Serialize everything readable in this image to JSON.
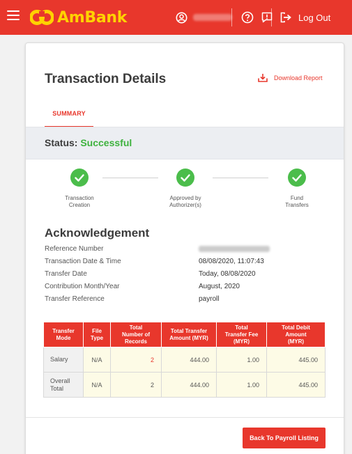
{
  "app": {
    "brand": "AmBank",
    "logout_label": "Log Out"
  },
  "page": {
    "title": "Transaction Details",
    "download_label": "Download Report",
    "tab_summary": "SUMMARY",
    "status_label": "Status:",
    "status_value": "Successful"
  },
  "steps": [
    {
      "label_line1": "Transaction",
      "label_line2": "Creation"
    },
    {
      "label_line1": "Approved by",
      "label_line2": "Authorizer(s)"
    },
    {
      "label_line1": "Fund",
      "label_line2": "Transfers"
    }
  ],
  "acknowledgement": {
    "title": "Acknowledgement",
    "rows": [
      {
        "label": "Reference Number",
        "value": ""
      },
      {
        "label": "Transaction Date & Time",
        "value": "08/08/2020, 11:07:43"
      },
      {
        "label": "Transfer Date",
        "value": "Today, 08/08/2020"
      },
      {
        "label": "Contribution Month/Year",
        "value": "August, 2020"
      },
      {
        "label": "Transfer Reference",
        "value": "payroll"
      }
    ]
  },
  "table": {
    "headers": [
      [
        "Transfer",
        "Mode"
      ],
      [
        "File",
        "Type"
      ],
      [
        "Total",
        "Number of",
        "Records"
      ],
      [
        "Total Transfer",
        "Amount (MYR)"
      ],
      [
        "Total",
        "Transfer Fee",
        "(MYR)"
      ],
      [
        "Total Debit",
        "Amount",
        "(MYR)"
      ]
    ],
    "rows": [
      {
        "mode": "Salary",
        "file_type": "N/A",
        "records": "2",
        "transfer_amount": "444.00",
        "fee": "1.00",
        "debit": "445.00"
      },
      {
        "mode": "Overall Total",
        "file_type": "N/A",
        "records": "2",
        "transfer_amount": "444.00",
        "fee": "1.00",
        "debit": "445.00"
      }
    ]
  },
  "footer": {
    "back_label": "Back To Payroll Listing"
  },
  "colors": {
    "brand_red": "#e8372c",
    "logo_yellow": "#ffd200",
    "success_green": "#4bbd4b"
  }
}
